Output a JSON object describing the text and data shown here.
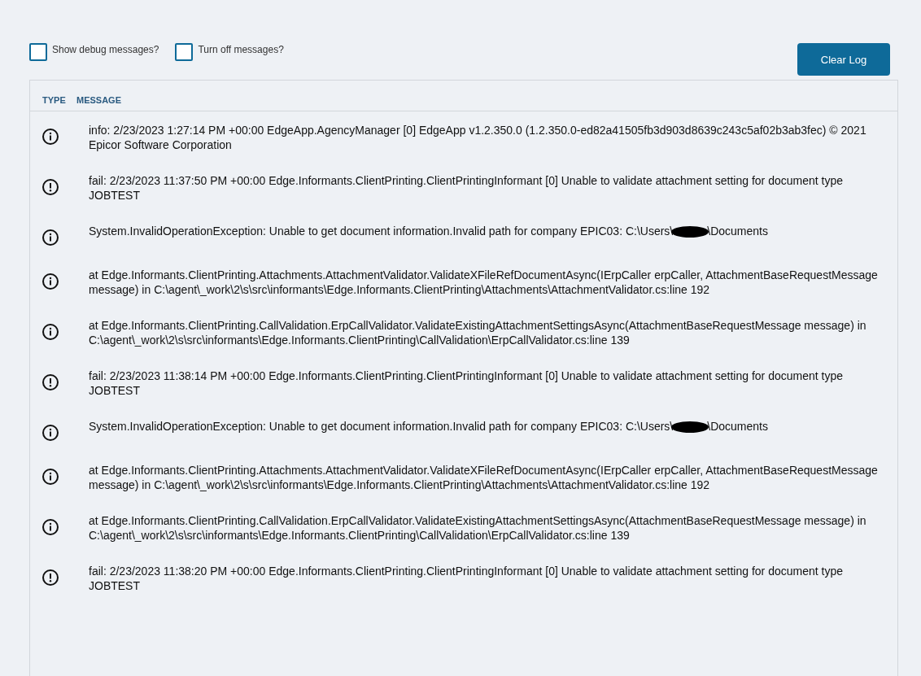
{
  "options": [
    {
      "label": "Show debug messages?",
      "checked": false
    },
    {
      "label": "Turn off messages?",
      "checked": false
    }
  ],
  "clear_button": "Clear Log",
  "table": {
    "columns": [
      "TYPE",
      "MESSAGE"
    ],
    "rows": [
      {
        "kind": "info",
        "message": "info: 2/23/2023 1:27:14 PM +00:00 EdgeApp.AgencyManager [0] EdgeApp v1.2.350.0 (1.2.350.0-ed82a41505fb3d903d8639c243c5af02b3ab3fec) © 2021 Epicor Software Corporation"
      },
      {
        "kind": "fail",
        "message": "fail: 2/23/2023 11:37:50 PM +00:00 Edge.Informants.ClientPrinting.ClientPrintingInformant [0] Unable to validate attachment setting for document type JOBTEST"
      },
      {
        "kind": "info",
        "message": "System.InvalidOperationException: Unable to get document information.Invalid path for company EPIC03: C:\\Users\\",
        "redacted": true,
        "message_end": "\\Documents"
      },
      {
        "kind": "info",
        "message": "at Edge.Informants.ClientPrinting.Attachments.AttachmentValidator.ValidateXFileRefDocumentAsync(IErpCaller erpCaller, AttachmentBaseRequestMessage message) in C:\\agent\\_work\\2\\s\\src\\informants\\Edge.Informants.ClientPrinting\\Attachments\\AttachmentValidator.cs:line 192"
      },
      {
        "kind": "info",
        "message": "at Edge.Informants.ClientPrinting.CallValidation.ErpCallValidator.ValidateExistingAttachmentSettingsAsync(AttachmentBaseRequestMessage message) in C:\\agent\\_work\\2\\s\\src\\informants\\Edge.Informants.ClientPrinting\\CallValidation\\ErpCallValidator.cs:line 139"
      },
      {
        "kind": "fail",
        "message": "fail: 2/23/2023 11:38:14 PM +00:00 Edge.Informants.ClientPrinting.ClientPrintingInformant [0] Unable to validate attachment setting for document type JOBTEST"
      },
      {
        "kind": "info",
        "message": "System.InvalidOperationException: Unable to get document information.Invalid path for company EPIC03: C:\\Users\\",
        "redacted": true,
        "message_end": "\\Documents"
      },
      {
        "kind": "info",
        "message": "at Edge.Informants.ClientPrinting.Attachments.AttachmentValidator.ValidateXFileRefDocumentAsync(IErpCaller erpCaller, AttachmentBaseRequestMessage message) in C:\\agent\\_work\\2\\s\\src\\informants\\Edge.Informants.ClientPrinting\\Attachments\\AttachmentValidator.cs:line 192"
      },
      {
        "kind": "info",
        "message": "at Edge.Informants.ClientPrinting.CallValidation.ErpCallValidator.ValidateExistingAttachmentSettingsAsync(AttachmentBaseRequestMessage message) in C:\\agent\\_work\\2\\s\\src\\informants\\Edge.Informants.ClientPrinting\\CallValidation\\ErpCallValidator.cs:line 139"
      },
      {
        "kind": "fail",
        "message": "fail: 2/23/2023 11:38:20 PM +00:00 Edge.Informants.ClientPrinting.ClientPrintingInformant [0] Unable to validate attachment setting for document type JOBTEST"
      }
    ]
  }
}
